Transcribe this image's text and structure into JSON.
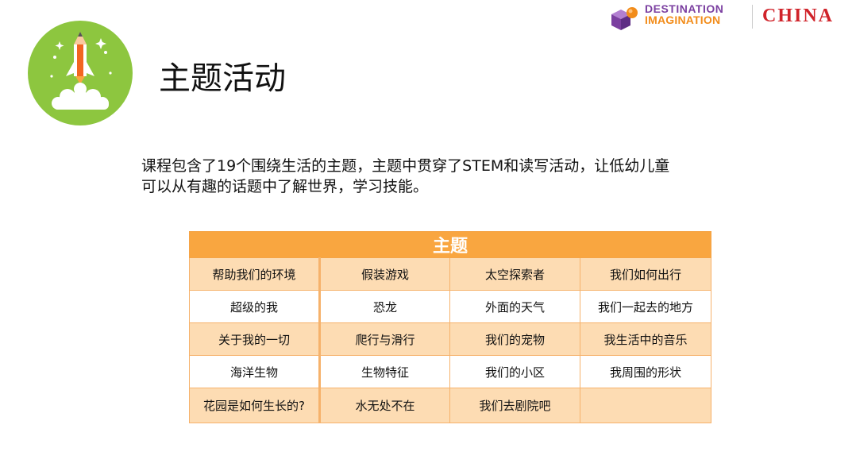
{
  "logo": {
    "line1": "DESTINATION",
    "line2": "IMAGINATION",
    "region": "CHINA",
    "colors": {
      "purple": "#7b3fa0",
      "orange": "#f28c1a",
      "red": "#d0232a"
    }
  },
  "badge": {
    "icon": "rocket-launch-icon",
    "background": "#8dc63f"
  },
  "title": "主题活动",
  "intro": {
    "line1": "课程包含了19个围绕生活的主题，主题中贯穿了STEM和读写活动，让低幼儿童",
    "line2": "可以从有趣的话题中了解世界，学习技能。"
  },
  "table": {
    "header": "主题",
    "header_color": "#f9a640",
    "rows": [
      [
        "帮助我们的环境",
        "假装游戏",
        "太空探索者",
        "我们如何出行"
      ],
      [
        "超级的我",
        "恐龙",
        "外面的天气",
        "我们一起去的地方"
      ],
      [
        "关于我的一切",
        "爬行与滑行",
        "我们的宠物",
        "我生活中的音乐"
      ],
      [
        "海洋生物",
        "生物特征",
        "我们的小区",
        "我周围的形状"
      ],
      [
        "花园是如何生长的?",
        "水无处不在",
        "我们去剧院吧",
        ""
      ]
    ]
  }
}
